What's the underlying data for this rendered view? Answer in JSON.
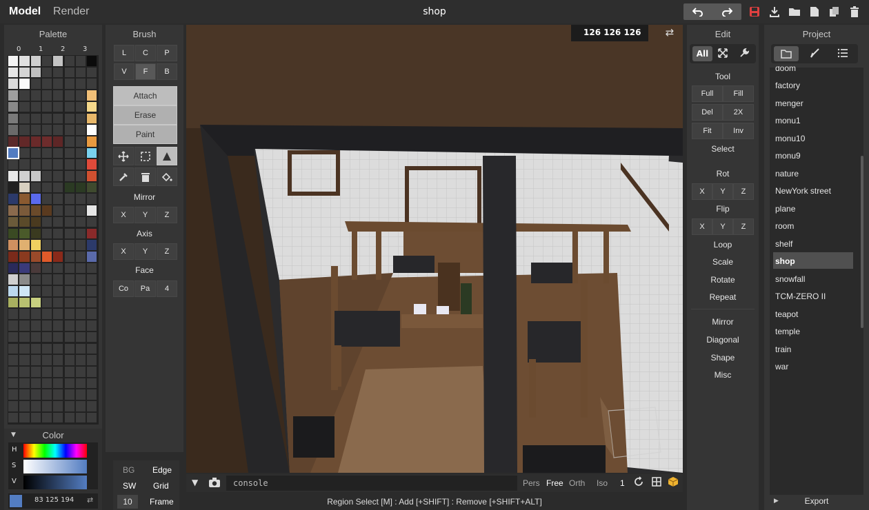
{
  "topbar": {
    "mode_model": "Model",
    "mode_render": "Render",
    "title": "shop"
  },
  "coords": "126 126 126",
  "palette": {
    "title": "Palette",
    "columns": [
      "0",
      "1",
      "2",
      "3"
    ]
  },
  "color": {
    "title": "Color",
    "h": "H",
    "s": "S",
    "v": "V",
    "rgb": "83 125 194",
    "selected_color": "#537dc2"
  },
  "brush": {
    "title": "Brush",
    "row1": [
      "L",
      "C",
      "P"
    ],
    "row2": [
      "V",
      "F",
      "B"
    ],
    "modes": [
      "Attach",
      "Erase",
      "Paint"
    ],
    "mirror": "Mirror",
    "axis": "Axis",
    "face": "Face",
    "xyz": [
      "X",
      "Y",
      "Z"
    ],
    "face_btns": [
      "Co",
      "Pa",
      "4"
    ]
  },
  "bottom_left": {
    "bg": "BG",
    "edge": "Edge",
    "sw": "SW",
    "grid": "Grid",
    "frame_num": "10",
    "frame": "Frame"
  },
  "viewport": {
    "console_placeholder": "console",
    "cams": [
      "Pers",
      "Free",
      "Orth",
      "Iso"
    ],
    "cam_num": "1"
  },
  "status": "Region Select [M] : Add [+SHIFT] : Remove [+SHIFT+ALT]",
  "edit": {
    "title": "Edit",
    "all": "All",
    "tool": "Tool",
    "tool_btns": [
      "Full",
      "Fill",
      "Del",
      "2X",
      "Fit",
      "Inv"
    ],
    "select": "Select",
    "rot": "Rot",
    "flip": "Flip",
    "xyz": [
      "X",
      "Y",
      "Z"
    ],
    "items": [
      "Loop",
      "Scale",
      "Rotate",
      "Repeat",
      "Mirror",
      "Diagonal",
      "Shape",
      "Misc"
    ]
  },
  "project": {
    "title": "Project",
    "items": [
      "doom",
      "factory",
      "menger",
      "monu1",
      "monu10",
      "monu9",
      "nature",
      "NewYork street",
      "plane",
      "room",
      "shelf",
      "shop",
      "snowfall",
      "TCM-ZERO II",
      "teapot",
      "temple",
      "train",
      "war"
    ],
    "selected": "shop",
    "export": "Export"
  }
}
